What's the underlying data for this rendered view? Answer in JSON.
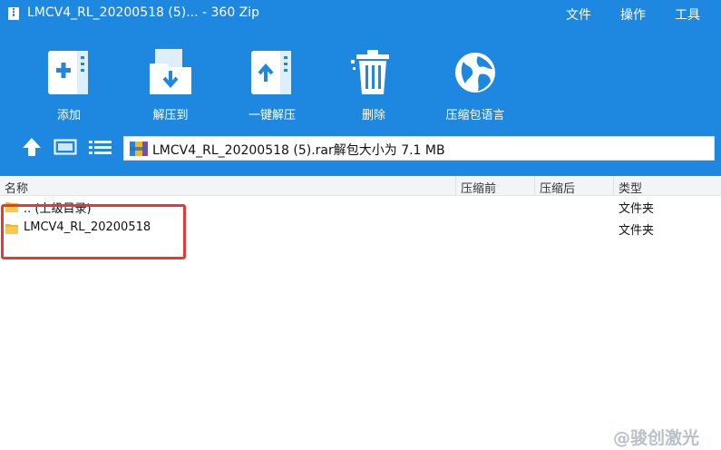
{
  "window": {
    "title": "LMCV4_RL_20200518 (5)... - 360 Zip",
    "menu": [
      "文件",
      "操作",
      "工具"
    ]
  },
  "toolbar": {
    "buttons": [
      {
        "label": "添加",
        "icon": "add-archive-icon"
      },
      {
        "label": "解压到",
        "icon": "extract-to-icon"
      },
      {
        "label": "一键解压",
        "icon": "one-click-extract-icon"
      },
      {
        "label": "删除",
        "icon": "trash-icon"
      },
      {
        "label": "压缩包语言",
        "icon": "globe-icon"
      }
    ]
  },
  "nav": {
    "path_text": "LMCV4_RL_20200518 (5).rar解包大小为 7.1 MB"
  },
  "columns": [
    "名称",
    "压缩前",
    "压缩后",
    "类型"
  ],
  "rows": [
    {
      "name": ".. (上级目录)",
      "type": "文件夹"
    },
    {
      "name": "LMCV4_RL_20200518",
      "type": "文件夹"
    }
  ],
  "colors": {
    "accent": "#1e88e0",
    "highlight": "#e53935",
    "folder": "#f4b52b"
  },
  "watermark": "@骏创激光"
}
